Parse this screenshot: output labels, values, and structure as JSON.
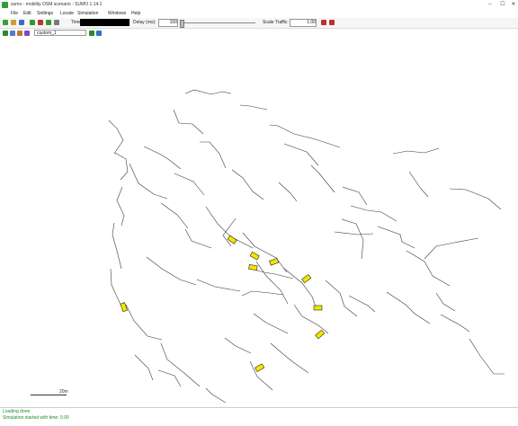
{
  "window": {
    "title": "sumo - mobility OSM scenario - SUMO 1.14.1",
    "minimize": "–",
    "maximize": "☐",
    "close": "✕"
  },
  "menu": [
    "File",
    "Edit",
    "Settings",
    "Locate",
    "Simulation",
    "Windows",
    "Help"
  ],
  "toolbar": {
    "time_label": "Time:",
    "delay_label": "Delay (ms):",
    "delay_value": "100",
    "scale_label": "Scale Traffic:",
    "scale_value": "1.00"
  },
  "view": {
    "scheme": "custom_1"
  },
  "canvas": {
    "scale_text": "20m"
  },
  "messages": [
    "Loading done.",
    "Simulation started with time: 0.00"
  ],
  "colors": {
    "road": "#3a3a3a",
    "vehicle": "#f2e600"
  }
}
